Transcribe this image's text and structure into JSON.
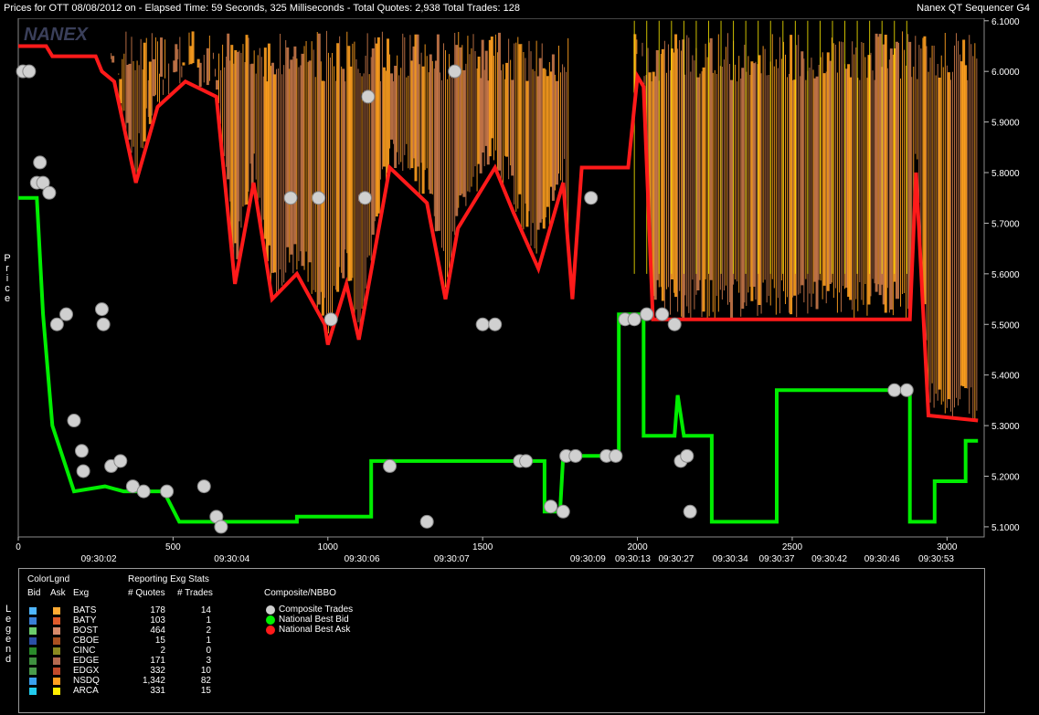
{
  "header": {
    "title": "Prices for OTT 08/08/2012 on   -  Elapsed Time: 59 Seconds, 325 Milliseconds  -  Total Quotes: 2,938  Total Trades: 128",
    "app_name": "Nanex QT Sequencer G4"
  },
  "watermark": "NANEX",
  "chart_data": {
    "type": "line",
    "title": "",
    "ylabel": "Price",
    "xlim": [
      0,
      3120
    ],
    "ylim": [
      5.08,
      6.105
    ],
    "y_ticks": [
      "6.1000",
      "6.0000",
      "5.9000",
      "5.8000",
      "5.7000",
      "5.6000",
      "5.5000",
      "5.4000",
      "5.3000",
      "5.2000",
      "5.1000"
    ],
    "x_ticks": [
      {
        "value": 0,
        "label": "0"
      },
      {
        "value": 500,
        "label": "500"
      },
      {
        "value": 1000,
        "label": "1000"
      },
      {
        "value": 1500,
        "label": "1500"
      },
      {
        "value": 2000,
        "label": "2000"
      },
      {
        "value": 2500,
        "label": "2500"
      },
      {
        "value": 3000,
        "label": "3000"
      }
    ],
    "time_labels": [
      {
        "value": 260,
        "label": "09:30:02"
      },
      {
        "value": 690,
        "label": "09:30:04"
      },
      {
        "value": 1110,
        "label": "09:30:06"
      },
      {
        "value": 1400,
        "label": "09:30:07"
      },
      {
        "value": 1840,
        "label": "09:30:09"
      },
      {
        "value": 1985,
        "label": "09:30:13"
      },
      {
        "value": 2125,
        "label": "09:30:27"
      },
      {
        "value": 2300,
        "label": "09:30:34"
      },
      {
        "value": 2450,
        "label": "09:30:37"
      },
      {
        "value": 2620,
        "label": "09:30:42"
      },
      {
        "value": 2790,
        "label": "09:30:46"
      },
      {
        "value": 2965,
        "label": "09:30:53"
      }
    ],
    "series": [
      {
        "name": "National Best Bid",
        "color": "#00ee00",
        "points": [
          [
            0,
            5.75
          ],
          [
            60,
            5.75
          ],
          [
            80,
            5.52
          ],
          [
            110,
            5.3
          ],
          [
            180,
            5.17
          ],
          [
            280,
            5.18
          ],
          [
            340,
            5.17
          ],
          [
            420,
            5.17
          ],
          [
            470,
            5.17
          ],
          [
            520,
            5.11
          ],
          [
            740,
            5.11
          ],
          [
            900,
            5.11
          ],
          [
            900,
            5.12
          ],
          [
            1140,
            5.12
          ],
          [
            1140,
            5.23
          ],
          [
            1700,
            5.23
          ],
          [
            1700,
            5.13
          ],
          [
            1750,
            5.13
          ],
          [
            1760,
            5.24
          ],
          [
            1940,
            5.24
          ],
          [
            1940,
            5.52
          ],
          [
            2020,
            5.52
          ],
          [
            2020,
            5.28
          ],
          [
            2120,
            5.28
          ],
          [
            2130,
            5.36
          ],
          [
            2150,
            5.28
          ],
          [
            2240,
            5.28
          ],
          [
            2240,
            5.11
          ],
          [
            2450,
            5.11
          ],
          [
            2450,
            5.37
          ],
          [
            2880,
            5.37
          ],
          [
            2880,
            5.11
          ],
          [
            2960,
            5.11
          ],
          [
            2960,
            5.19
          ],
          [
            3060,
            5.19
          ],
          [
            3060,
            5.27
          ],
          [
            3100,
            5.27
          ]
        ]
      },
      {
        "name": "National Best Ask",
        "color": "#ff1a1a",
        "points": [
          [
            0,
            6.05
          ],
          [
            90,
            6.05
          ],
          [
            110,
            6.03
          ],
          [
            250,
            6.03
          ],
          [
            270,
            6.0
          ],
          [
            310,
            5.98
          ],
          [
            380,
            5.78
          ],
          [
            450,
            5.93
          ],
          [
            540,
            5.98
          ],
          [
            640,
            5.95
          ],
          [
            700,
            5.58
          ],
          [
            760,
            5.78
          ],
          [
            820,
            5.55
          ],
          [
            900,
            5.6
          ],
          [
            990,
            5.5
          ],
          [
            1000,
            5.46
          ],
          [
            1060,
            5.58
          ],
          [
            1100,
            5.47
          ],
          [
            1200,
            5.81
          ],
          [
            1320,
            5.74
          ],
          [
            1380,
            5.55
          ],
          [
            1420,
            5.69
          ],
          [
            1540,
            5.81
          ],
          [
            1600,
            5.72
          ],
          [
            1680,
            5.61
          ],
          [
            1760,
            5.78
          ],
          [
            1790,
            5.55
          ],
          [
            1820,
            5.81
          ],
          [
            1950,
            5.81
          ],
          [
            1970,
            5.81
          ],
          [
            2000,
            5.99
          ],
          [
            2020,
            5.97
          ],
          [
            2050,
            5.51
          ],
          [
            2880,
            5.51
          ],
          [
            2900,
            5.8
          ],
          [
            2940,
            5.32
          ],
          [
            3100,
            5.31
          ]
        ]
      },
      {
        "name": "Composite Trades",
        "color": "#d0d0d0",
        "points": [
          [
            15,
            6.0
          ],
          [
            35,
            6.0
          ],
          [
            70,
            5.82
          ],
          [
            60,
            5.78
          ],
          [
            80,
            5.78
          ],
          [
            100,
            5.76
          ],
          [
            125,
            5.5
          ],
          [
            155,
            5.52
          ],
          [
            180,
            5.31
          ],
          [
            205,
            5.25
          ],
          [
            210,
            5.21
          ],
          [
            270,
            5.53
          ],
          [
            275,
            5.5
          ],
          [
            300,
            5.22
          ],
          [
            330,
            5.23
          ],
          [
            370,
            5.18
          ],
          [
            405,
            5.17
          ],
          [
            480,
            5.17
          ],
          [
            600,
            5.18
          ],
          [
            640,
            5.12
          ],
          [
            655,
            5.1
          ],
          [
            880,
            5.75
          ],
          [
            970,
            5.75
          ],
          [
            1010,
            5.51
          ],
          [
            1120,
            5.75
          ],
          [
            1200,
            5.22
          ],
          [
            1320,
            5.11
          ],
          [
            1410,
            6.0
          ],
          [
            1500,
            5.5
          ],
          [
            1540,
            5.5
          ],
          [
            1620,
            5.23
          ],
          [
            1640,
            5.23
          ],
          [
            1720,
            5.14
          ],
          [
            1760,
            5.13
          ],
          [
            1770,
            5.24
          ],
          [
            1800,
            5.24
          ],
          [
            1850,
            5.75
          ],
          [
            1900,
            5.24
          ],
          [
            1930,
            5.24
          ],
          [
            1960,
            5.51
          ],
          [
            1990,
            5.51
          ],
          [
            2030,
            5.52
          ],
          [
            2080,
            5.52
          ],
          [
            2120,
            5.5
          ],
          [
            2140,
            5.23
          ],
          [
            2160,
            5.24
          ],
          [
            2170,
            5.13
          ],
          [
            2830,
            5.37
          ],
          [
            2870,
            5.37
          ],
          [
            1130,
            5.95
          ]
        ]
      }
    ]
  },
  "legend": {
    "color_legend_title": "ColorLgnd",
    "stats_title": "Reporting Exg Stats",
    "composite_title": "Composite/NBBO",
    "side_label": "Legend",
    "col_bid": "Bid",
    "col_ask": "Ask",
    "col_exg": "Exg",
    "col_quotes": "# Quotes",
    "col_trades": "# Trades",
    "exchanges": [
      {
        "name": "BATS",
        "quotes": "178",
        "trades": "14",
        "bid_color": "#4fb6ff",
        "ask_color": "#ffaa33"
      },
      {
        "name": "BATY",
        "quotes": "103",
        "trades": "1",
        "bid_color": "#3a7fd6",
        "ask_color": "#e05a2a"
      },
      {
        "name": "BOST",
        "quotes": "464",
        "trades": "2",
        "bid_color": "#6ccc6c",
        "ask_color": "#d88a6a"
      },
      {
        "name": "CBOE",
        "quotes": "15",
        "trades": "1",
        "bid_color": "#2b4fa6",
        "ask_color": "#a85020"
      },
      {
        "name": "CINC",
        "quotes": "2",
        "trades": "0",
        "bid_color": "#2a8a2a",
        "ask_color": "#8a8a20"
      },
      {
        "name": "EDGE",
        "quotes": "171",
        "trades": "3",
        "bid_color": "#3e8f3e",
        "ask_color": "#b56a50"
      },
      {
        "name": "EDGX",
        "quotes": "332",
        "trades": "10",
        "bid_color": "#4a9a4a",
        "ask_color": "#c24a2a"
      },
      {
        "name": "NSDQ",
        "quotes": "1,342",
        "trades": "82",
        "bid_color": "#3aa0ee",
        "ask_color": "#ffa020"
      },
      {
        "name": "ARCA",
        "quotes": "331",
        "trades": "15",
        "bid_color": "#22ccee",
        "ask_color": "#ffee00"
      }
    ],
    "composite": [
      {
        "label": "Composite Trades",
        "color": "#cfcfcf"
      },
      {
        "label": "National Best Bid",
        "color": "#00ee00"
      },
      {
        "label": "National Best Ask",
        "color": "#ff1a1a"
      }
    ]
  }
}
